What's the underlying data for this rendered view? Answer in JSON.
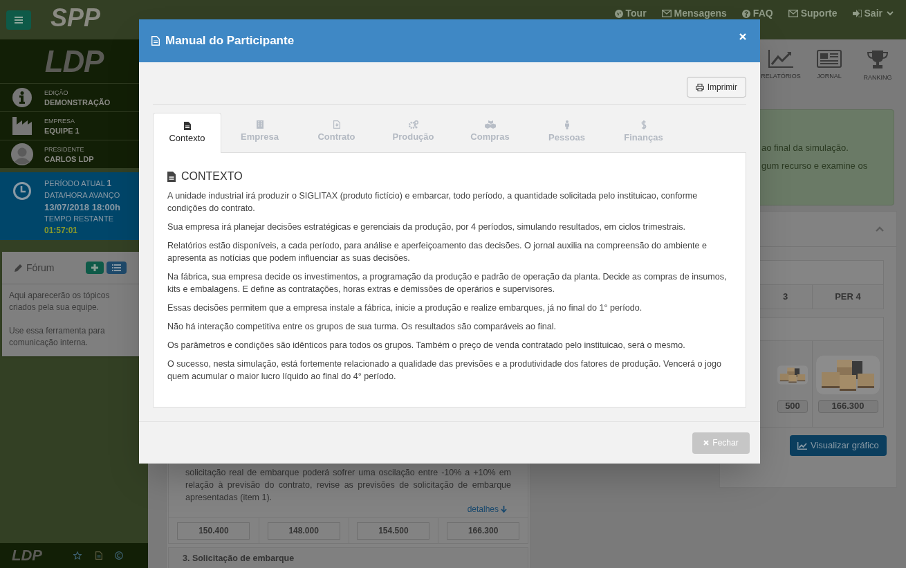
{
  "topbar": {
    "brand": "SPP",
    "links": [
      {
        "label": "Tour"
      },
      {
        "label": "Mensagens"
      },
      {
        "label": "FAQ"
      },
      {
        "label": "Suporte"
      },
      {
        "label": "Sair"
      }
    ]
  },
  "sidebar": {
    "logo": "LDP",
    "info": [
      {
        "label": "EDIÇÃO",
        "value": "DEMONSTRAÇÃO"
      },
      {
        "label": "EMPRESA",
        "value": "EQUIPE 1"
      },
      {
        "label": "PRESIDENTE",
        "value": "CARLOS LDP"
      }
    ],
    "period": {
      "label": "PERÍODO ATUAL",
      "number": "1",
      "deadline_label": "DATA/HORA AVANÇO",
      "deadline": "13/07/2018 18:00h",
      "remaining_label": "TEMPO RESTANTE",
      "remaining": "01:57:01"
    },
    "forum": {
      "title": "Fórum",
      "paragraphs": [
        "Aqui aparecerão os tópicos criados pela sua equipe.",
        "Use essa ferramenta para comunicação interna."
      ]
    },
    "footer_logo": "LDP"
  },
  "nav": [
    {
      "label": "RELATÓRIOS"
    },
    {
      "label": "JORNAL"
    },
    {
      "label": "RANKING"
    }
  ],
  "alert": {
    "lines": [
      "ao final da simulação.",
      "gum recurso e examine os"
    ]
  },
  "forecast_table": {
    "headers": [
      "3",
      "PER 4"
    ],
    "values": [
      "500",
      "166.300"
    ]
  },
  "chart_button": "Visualizar gráfico",
  "shipment_panel": {
    "text": "solicitação real de embarque poderá sofrer uma oscilação entre -10% a +10% em relação à previsão do contrato, revise as previsões de solicitação de embarque apresentadas (item 1).",
    "link": "detalhes",
    "values": [
      "150.400",
      "148.000",
      "154.500",
      "166.300"
    ],
    "next_heading": "3. Solicitação de embarque"
  },
  "modal": {
    "title": "Manual do Participante",
    "print_button": "Imprimir",
    "tabs": [
      {
        "label": "Contexto",
        "selected": true
      },
      {
        "label": "Empresa",
        "selected": false
      },
      {
        "label": "Contrato",
        "selected": false
      },
      {
        "label": "Produção",
        "selected": false
      },
      {
        "label": "Compras",
        "selected": false
      },
      {
        "label": "Pessoas",
        "selected": false
      },
      {
        "label": "Finanças",
        "selected": false
      }
    ],
    "section_title": "CONTEXTO",
    "paragraphs": [
      "A unidade industrial irá produzir o SIGLITAX (produto fictício) e embarcar, todo período, a quantidade solicitada pelo instituicao, conforme condições do contrato.",
      "Sua empresa irá planejar decisões estratégicas e gerenciais da produção, por 4 períodos, simulando resultados, em ciclos trimestrais.",
      "Relatórios estão disponíveis, a cada período, para análise e aperfeiçoamento das decisões. O jornal auxilia na compreensão do ambiente e apresenta as notícias que podem influenciar as suas decisões.",
      "Na fábrica, sua empresa decide os investimentos, a programação da produção e padrão de operação da planta. Decide as compras de insumos, kits e embalagens. E define as contratações, horas extras e demissões de operários e supervisores.",
      "Essas decisões permitem que a empresa instale a fábrica, inicie a produção e realize embarques, já no final do 1° período.",
      "Não há interação competitiva entre os grupos de sua turma. Os resultados são comparáveis ao final.",
      "Os parâmetros e condições são idênticos para todos os grupos. Também o preço de venda contratado pelo instituicao, será o mesmo.",
      "O sucesso, nesta simulação, está fortemente relacionado a qualidade das previsões e a produtividade dos fatores de produção. Vencerá o jogo quem acumular o maior lucro líquido ao final do 4° período."
    ],
    "close_button": "Fechar"
  }
}
